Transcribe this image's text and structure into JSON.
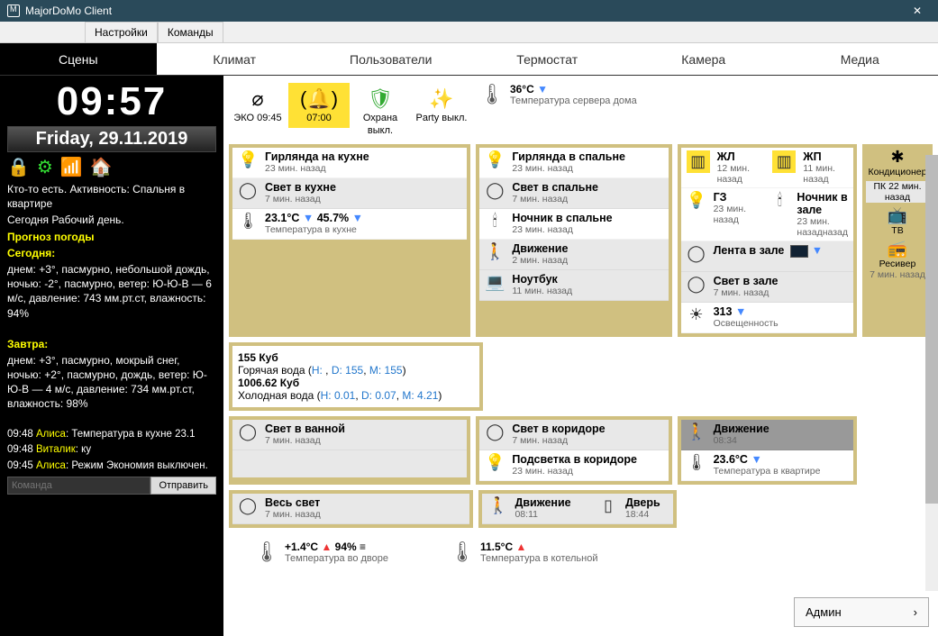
{
  "window": {
    "title": "MajorDoMo Client"
  },
  "menu": {
    "settings": "Настройки",
    "commands": "Команды"
  },
  "tabs": [
    "Сцены",
    "Климат",
    "Пользователи",
    "Термостат",
    "Камера",
    "Медиа"
  ],
  "clock": {
    "time": "09:57",
    "date": "Friday, 29.11.2019"
  },
  "activity": {
    "line1": "Кто-то есть. Активность: Спальня в квартире",
    "line2": "Сегодня Рабочий день."
  },
  "forecast": {
    "header": "Прогноз погоды",
    "today_label": "Сегодня:",
    "today": "днем: +3°, пасмурно, небольшой дождь, ночью: -2°, пасмурно, ветер: Ю-Ю-В — 6 м/с, давление: 743 мм.рт.ст, влажность: 94%",
    "tomorrow_label": "Завтра:",
    "tomorrow": "днем: +3°, пасмурно, мокрый снег, ночью: +2°, пасмурно, дождь, ветер: Ю-Ю-В — 4 м/с, давление: 734 мм.рт.ст, влажность: 98%"
  },
  "log": [
    {
      "time": "09:48",
      "src": "Алиса",
      "msg": ": Температура в кухне 23.1"
    },
    {
      "time": "09:48",
      "src": "Виталик",
      "msg": ": ку"
    },
    {
      "time": "09:45",
      "src": "Алиса",
      "msg": ": Режим Экономия выключен."
    }
  ],
  "cmd": {
    "placeholder": "Команда",
    "send": "Отправить"
  },
  "toolbar": {
    "eco": "ЭКО 09:45",
    "alarm": "07:00",
    "guard": "Охрана выкл.",
    "party": "Party выкл."
  },
  "server_temp": {
    "value": "36°C",
    "label": "Температура сервера дома"
  },
  "kitchen": {
    "garland": {
      "title": "Гирлянда на кухне",
      "sub": "23 мин. назад"
    },
    "light": {
      "title": "Свет в кухне",
      "sub": "7 мин. назад"
    },
    "temp": {
      "val": "23.1°C",
      "hum": "45.7%",
      "label": "Температура в кухне"
    }
  },
  "bedroom": {
    "garland": {
      "title": "Гирлянда в спальне",
      "sub": "23 мин. назад"
    },
    "light": {
      "title": "Свет в спальне",
      "sub": "7 мин. назад"
    },
    "lamp": {
      "title": "Ночник в спальне",
      "sub": "23 мин. назад"
    },
    "motion": {
      "title": "Движение",
      "sub": "2 мин. назад"
    },
    "laptop": {
      "title": "Ноутбук",
      "sub": "11 мин. назад"
    }
  },
  "hall": {
    "jl": {
      "title": "ЖЛ",
      "sub": "12 мин. назад"
    },
    "jp": {
      "title": "ЖП",
      "sub": "11 мин. назад"
    },
    "gz": {
      "title": "ГЗ",
      "sub": "23 мин. назад"
    },
    "night": {
      "title": "Ночник в зале",
      "sub": "23 мин. назадназад"
    },
    "strip": {
      "title": "Лента в зале"
    },
    "light": {
      "title": "Свет в зале",
      "sub": "7 мин. назад"
    },
    "lux": {
      "title": "313",
      "sub": "Освещенность"
    },
    "motion": {
      "title": "Движение",
      "sub": "08:34"
    },
    "temp": {
      "val": "23.6°C",
      "label": "Температура в квартире"
    }
  },
  "sidecol": {
    "ac": "Кондиционер",
    "pc": {
      "title": "ПК",
      "sub": "22 мин. назад"
    },
    "tv": "ТВ",
    "receiver": {
      "title": "Ресивер",
      "sub": "7 мин. назад"
    }
  },
  "water": {
    "hot_val": "155 Куб",
    "hot_label": "Горячая вода (",
    "hot_h": "H: ",
    "hot_d": "D: 155",
    "hot_m": "M: 155",
    "cold_val": "1006.62 Куб",
    "cold_label": "Холодная вода (",
    "cold_h": "H: 0.01",
    "cold_d": "D: 0.07",
    "cold_m": "M: 4.21"
  },
  "bathroom": {
    "light": {
      "title": "Свет в ванной",
      "sub": "7 мин. назад"
    }
  },
  "corridor": {
    "light": {
      "title": "Свет в коридоре",
      "sub": "7 мин. назад"
    },
    "backlit": {
      "title": "Подсветка в коридоре",
      "sub": "23 мин. назад"
    },
    "motion": {
      "title": "Движение",
      "sub": "08:11"
    },
    "door": {
      "title": "Дверь",
      "sub": "18:44"
    }
  },
  "all_light": {
    "title": "Весь свет",
    "sub": "7 мин. назад"
  },
  "footer": {
    "outdoor": {
      "val": "+1.4°C",
      "hum": "94%",
      "label": "Температура во дворе"
    },
    "boiler": {
      "val": "11.5°C",
      "label": "Температура в котельной"
    },
    "admin": "Админ"
  }
}
